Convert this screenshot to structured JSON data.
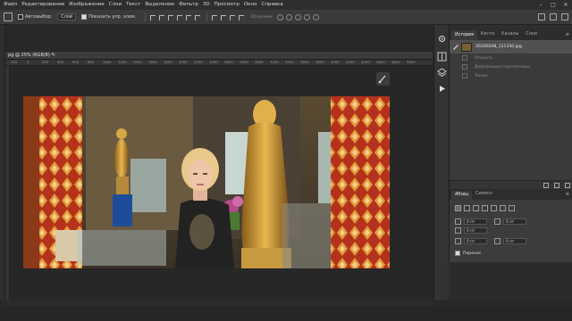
{
  "menu": {
    "items": [
      "Файл",
      "Редактирование",
      "Изображение",
      "Слои",
      "Текст",
      "Выделение",
      "Фильтр",
      "3D",
      "Просмотр",
      "Окно",
      "Справка"
    ],
    "window_controls": [
      "–",
      "□",
      "✕"
    ]
  },
  "options_bar": {
    "autoselect_label": "Автовыбор:",
    "autoselect_value": "Слой",
    "show_controls_label": "Показать упр. элем.",
    "mode3d_label": "3D-режим:"
  },
  "document": {
    "tab_title": "pg @ 25% (RGB/8) *",
    "tab_close": "×",
    "ruler_marks": [
      "200",
      "0",
      "200",
      "400",
      "600",
      "800",
      "1000",
      "1200",
      "1400",
      "1600",
      "1800",
      "2000",
      "2200",
      "2400",
      "2600",
      "2800",
      "3000",
      "3200",
      "3400",
      "3600",
      "3800",
      "4000",
      "4200",
      "4400",
      "4600",
      "4800",
      "5000"
    ],
    "status_text": "25%    1,7/11,6M"
  },
  "history_panel": {
    "tabs": [
      "История",
      "Кисти",
      "Каналы",
      "Слои"
    ],
    "snapshot_name": "20200208_121150.jpg",
    "steps": [
      "Открыть",
      "Деформация перспективы",
      "Линия"
    ]
  },
  "paragraph_panel": {
    "tabs": [
      "Абзац",
      "Символ"
    ],
    "fields": {
      "indent_left": "0 пт",
      "indent_right": "0 пт",
      "indent_first": "0 пт",
      "space_before": "0 пт",
      "space_after": "0 пт"
    },
    "hyphenation_label": "Перенос"
  },
  "colors": {
    "accent": "#3a3a3a",
    "menubar": "#2e2e2e",
    "panel": "#3a3a3a",
    "canvas": "#272727"
  }
}
